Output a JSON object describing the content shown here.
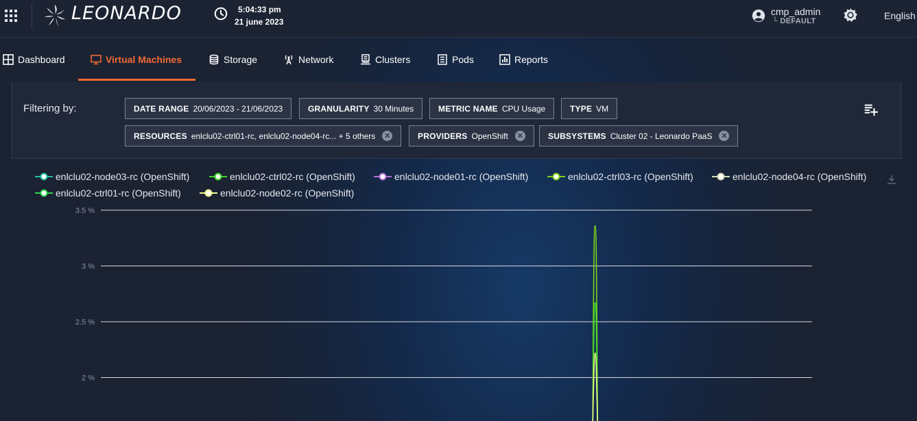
{
  "header": {
    "brand": "LEONARDO",
    "time": "5:04:33 pm",
    "date": "21 june 2023",
    "user_name": "cmp_admin",
    "user_domain": "└ DEFAULT",
    "language": "English",
    "icons": {
      "menu": "apps-grid-icon",
      "logo": "leonardo-logo-icon",
      "clock": "clock-icon",
      "user": "account-circle-icon",
      "theme": "brightness-icon"
    }
  },
  "nav": {
    "tabs": [
      {
        "label": "Dashboard",
        "icon": "dashboard-icon"
      },
      {
        "label": "Virtual Machines",
        "icon": "monitor-icon"
      },
      {
        "label": "Storage",
        "icon": "database-icon"
      },
      {
        "label": "Network",
        "icon": "antenna-icon"
      },
      {
        "label": "Clusters",
        "icon": "cluster-icon"
      },
      {
        "label": "Pods",
        "icon": "pods-icon"
      },
      {
        "label": "Reports",
        "icon": "reports-icon"
      }
    ],
    "active": "Virtual Machines",
    "accent_color": "#f26a36"
  },
  "filters": {
    "label": "Filtering by:",
    "chips": [
      {
        "key": "DATE RANGE",
        "value": "20/06/2023 - 21/06/2023"
      },
      {
        "key": "GRANULARITY",
        "value": "30 Minutes"
      },
      {
        "key": "METRIC NAME",
        "value": "CPU Usage"
      },
      {
        "key": "TYPE",
        "value": "VM"
      },
      {
        "key": "RESOURCES",
        "value": "enlclu02-ctrl01-rc, enlclu02-node04-rc... + 5 others"
      },
      {
        "key": "PROVIDERS",
        "value": "OpenShift"
      },
      {
        "key": "SUBSYSTEMS",
        "value": "Cluster 02 - Leonardo PaaS"
      }
    ],
    "save_icon": "note-add-icon"
  },
  "chart_data": {
    "type": "line",
    "ylabel": "",
    "xlabel": "",
    "yticks": [
      "3.5 %",
      "3 %",
      "2.5 %",
      "2 %"
    ],
    "ylim_visible": [
      1.6,
      3.5
    ],
    "legend_position": "top",
    "grid": true,
    "spike_x_fraction": 0.695,
    "series": [
      {
        "name": "enlclu02-node03-rc (OpenShift)",
        "color": "#1fbfa0",
        "peak": null
      },
      {
        "name": "enlclu02-ctrl02-rc (OpenShift)",
        "color": "#3fd62a",
        "peak": 2.67
      },
      {
        "name": "enlclu02-node01-rc (OpenShift)",
        "color": "#b36fd6",
        "peak": null
      },
      {
        "name": "enlclu02-ctrl03-rc (OpenShift)",
        "color": "#7fd21c",
        "peak": 3.36
      },
      {
        "name": "enlclu02-node04-rc (OpenShift)",
        "color": "#d8dcb6",
        "peak": null
      },
      {
        "name": "enlclu02-ctrl01-rc (OpenShift)",
        "color": "#2bd44c",
        "peak": null
      },
      {
        "name": "enlclu02-node02-rc (OpenShift)",
        "color": "#f1ff8a",
        "peak": 2.22
      }
    ],
    "download_icon": "download-icon"
  }
}
